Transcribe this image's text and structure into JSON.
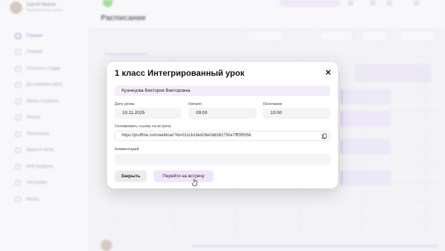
{
  "app": {
    "title": "Расписание",
    "profile_name": "Сергей Иванов",
    "profile_sub": "Администратор школы",
    "nav": [
      "Главная",
      "Ученики",
      "Учители и студии",
      "Достижения сайта",
      "Школы и работы",
      "Заказы",
      "Расписание",
      "Курсы и тесты",
      "Мой профиль",
      "Настройки",
      "Выход"
    ]
  },
  "modal": {
    "title": "1 класс Интегрированный урок",
    "teacher": "Кузнецова Виктория Викторовна",
    "date_label": "Дата урока",
    "date_value": "10.11.2025",
    "start_label": "Начало",
    "start_value": "09:00",
    "end_label": "Окончание",
    "end_value": "10:00",
    "link_label": "Скопировать ссылку на встречу",
    "link_value": "https://pruffme.com/webinar/?id=011cb18ed26e0dd362750e7fff3f555b",
    "comment_label": "Комментарий",
    "comment_value": "",
    "close_button": "Закрыть",
    "join_button": "Перейти на встречу",
    "close_icon": "close-icon",
    "copy_icon": "copy-icon"
  },
  "colors": {
    "accent": "#f1e5fb",
    "teacher_bg": "#f3ecfb",
    "field_bg": "#f4f4f6"
  }
}
